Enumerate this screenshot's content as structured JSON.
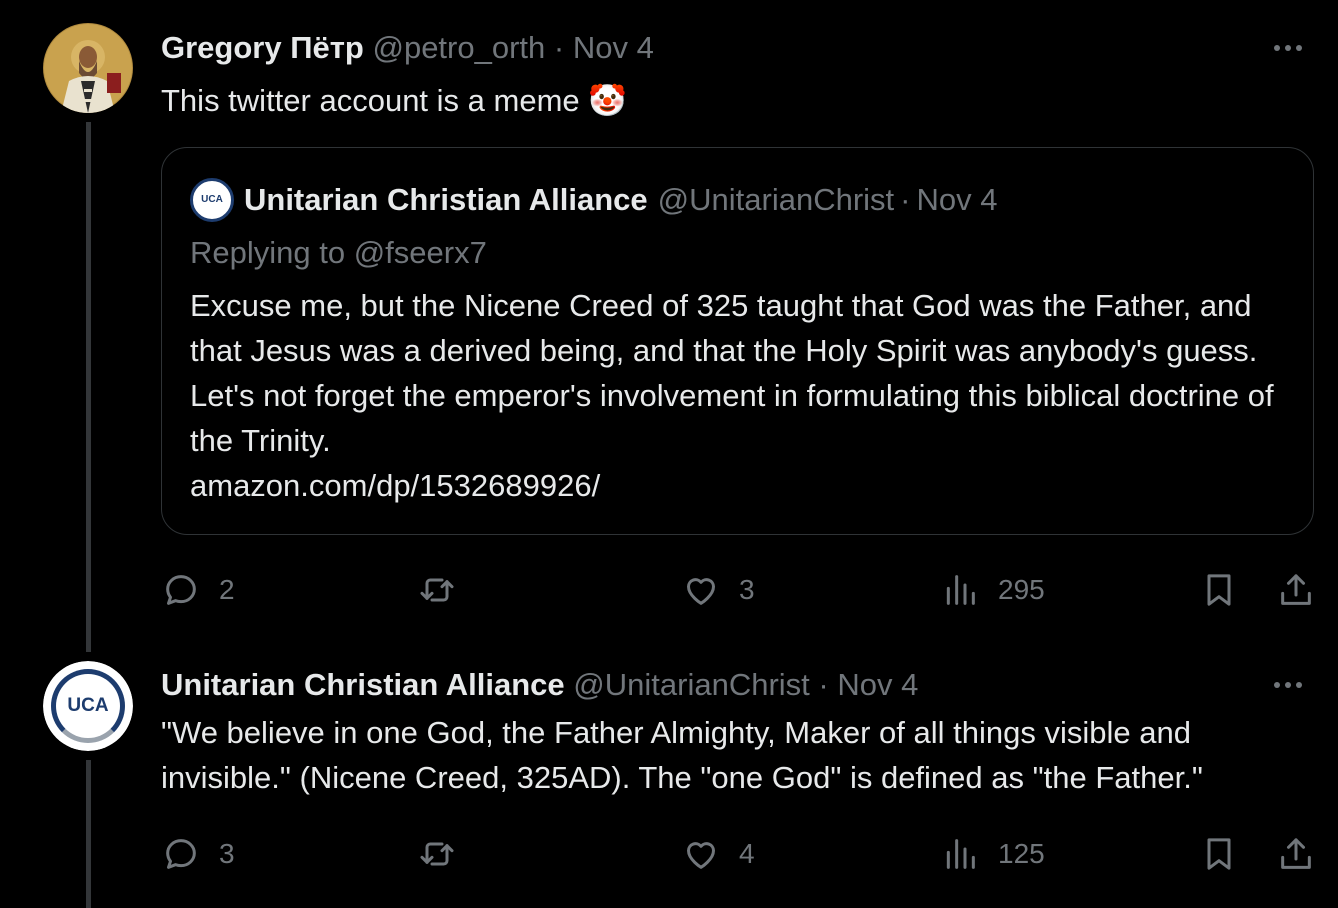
{
  "tweet1": {
    "display_name": "Gregory Пётр",
    "handle": "@petro_orth",
    "separator": "·",
    "date": "Nov 4",
    "text": "This twitter account is a meme",
    "emoji": "🤡",
    "quote": {
      "avatar_text": "UCA",
      "display_name": "Unitarian Christian Alliance",
      "handle": "@UnitarianChrist",
      "separator": "·",
      "date": "Nov 4",
      "replying_to": "Replying to @fseerx7",
      "text": "Excuse me, but the Nicene Creed of 325 taught that God was the Father, and that Jesus was a derived being, and that the Holy Spirit was anybody's guess. Let's not forget the emperor's involvement in formulating this biblical doctrine of the Trinity.",
      "link": "amazon.com/dp/1532689926/"
    },
    "actions": {
      "replies": "2",
      "retweets": "",
      "likes": "3",
      "views": "295"
    }
  },
  "tweet2": {
    "avatar_text": "UCA",
    "display_name": "Unitarian Christian Alliance",
    "handle": "@UnitarianChrist",
    "separator": "·",
    "date": "Nov 4",
    "text": "\"We believe in one God, the Father Almighty, Maker of all things visible and invisible.\" (Nicene Creed, 325AD). The \"one God\" is defined as \"the Father.\"",
    "actions": {
      "replies": "3",
      "retweets": "",
      "likes": "4",
      "views": "125"
    }
  },
  "colors": {
    "background": "#000000",
    "text": "#e7e9ea",
    "muted": "#71767b",
    "border": "#2f3336",
    "uca_blue": "#1d3c6e"
  },
  "icons": [
    "reply-icon",
    "retweet-icon",
    "like-icon",
    "views-icon",
    "bookmark-icon",
    "share-icon",
    "more-icon"
  ]
}
